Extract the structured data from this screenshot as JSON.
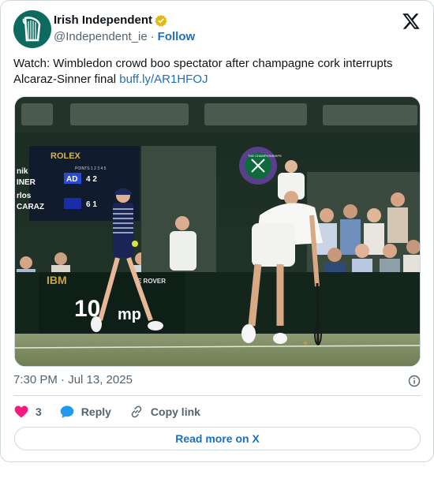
{
  "author": {
    "name": "Irish Independent",
    "handle": "@Independent_ie",
    "separator": "·",
    "follow_label": "Follow",
    "avatar_icon": "harp-icon",
    "verified_icon": "verified-gold-badge-icon"
  },
  "tweet": {
    "text": "Watch: Wimbledon crowd boo spectator after champagne cork interrupts Alcaraz-Sinner final",
    "link": "buff.ly/AR1HFOJ",
    "timestamp": "7:30 PM · Jul 13, 2025"
  },
  "photo": {
    "scoreboard_brand": "ROLEX",
    "players": [
      "nik",
      "INER",
      "rlos",
      "CARAZ"
    ],
    "row1_label": "AD",
    "row1_games": "4 2",
    "row2_games": "6 1",
    "points_header": "POINTS 1 2 3 4 5",
    "ad_brand": "IBM",
    "ad_brand2": "E ROVER",
    "speed_text": "10",
    "speed_unit": "mp",
    "badge_text": "THE CHAMPIONSHIPS"
  },
  "actions": {
    "like_count": "3",
    "reply_label": "Reply",
    "copy_label": "Copy link",
    "read_more_label": "Read more on X"
  },
  "colors": {
    "link": "#1d6fb8",
    "like": "#f91880",
    "reply": "#1d9bf0",
    "avatar_bg": "#0c6b5e",
    "verified": "#e2b719"
  }
}
